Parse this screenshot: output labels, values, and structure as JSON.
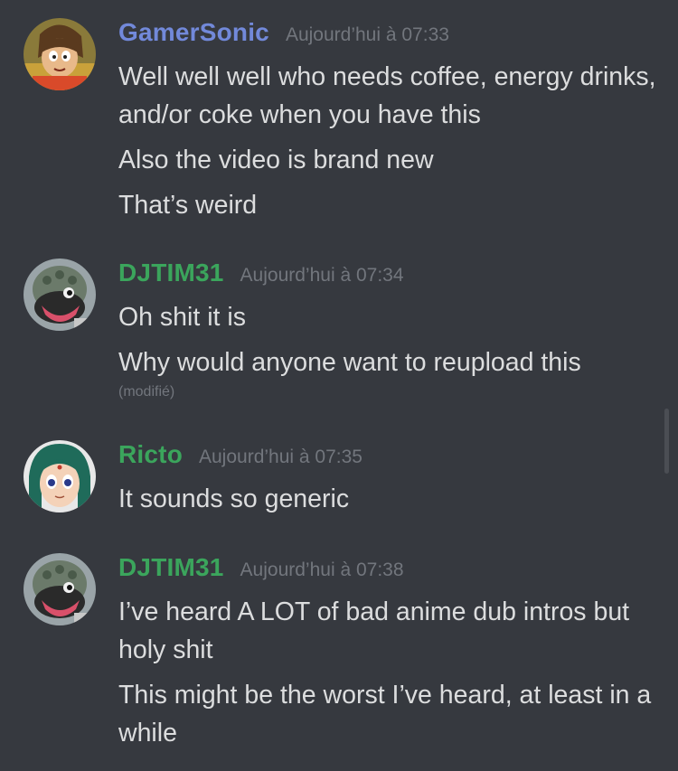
{
  "colors": {
    "background": "#36393f",
    "message_text": "#dcddde",
    "timestamp": "#72767d",
    "gamersonic": "#7289da",
    "djtim31": "#3ba55c",
    "ricto": "#3ba55c"
  },
  "groups": [
    {
      "author": "GamerSonic",
      "avatar": "gamersonic-avatar",
      "timestamp": "Aujourd’hui à 07:33",
      "messages": [
        "Well well well who needs coffee, energy drinks, and/or coke when you have this",
        "Also the video is brand new",
        "That’s weird"
      ]
    },
    {
      "author": "DJTIM31",
      "avatar": "djtim31-avatar",
      "timestamp": "Aujourd’hui à 07:34",
      "messages": [
        "Oh shit it is",
        "Why would anyone want to reupload this"
      ],
      "edited_label": "(modifié)"
    },
    {
      "author": "Ricto",
      "avatar": "ricto-avatar",
      "timestamp": "Aujourd’hui à 07:35",
      "messages": [
        "It sounds so generic"
      ]
    },
    {
      "author": "DJTIM31",
      "avatar": "djtim31-avatar",
      "timestamp": "Aujourd’hui à 07:38",
      "messages": [
        "I’ve heard A LOT of bad anime dub intros but holy shit",
        "This might be the worst I’ve heard, at least in a while"
      ]
    }
  ]
}
